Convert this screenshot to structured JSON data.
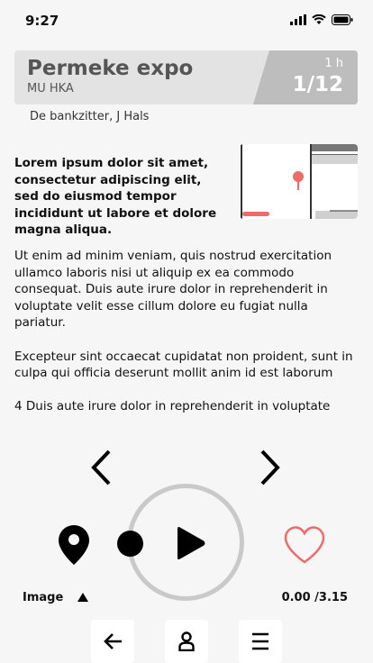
{
  "status": {
    "time": "9:27"
  },
  "header": {
    "title": "Permeke expo",
    "subtitle": "MU HKA",
    "duration": "1 h",
    "page": "1/12"
  },
  "artwork": "De bankzitter, J Hals",
  "lead_text": "Lorem ipsum dolor sit amet, consectetur adipiscing elit, sed do eiusmod tempor incididunt ut labore et dolore magna aliqua.",
  "paragraphs": [
    "Ut enim ad minim veniam,  quis nostrud exercitation ullamco laboris nisi ut aliquip ex ea commodo consequat. Duis aute irure dolor in reprehenderit in voluptate velit esse cillum dolore eu fugiat nulla pariatur.",
    "Excepteur sint occaecat cupidatat non proident, sunt in culpa qui officia deserunt mollit anim id est laborum",
    "4 Duis aute irure dolor in reprehenderit in voluptate"
  ],
  "player": {
    "media_label": "Image",
    "time": "0.00 /3.15"
  },
  "colors": {
    "accent": "#f06a6a",
    "header_badge": "#bdbdbd",
    "ring": "#c9c9c9"
  },
  "icons": [
    "signal-icon",
    "wifi-icon",
    "battery-icon",
    "map-pin-icon",
    "chevron-left-icon",
    "chevron-right-icon",
    "location-pin-icon",
    "play-icon",
    "heart-icon",
    "triangle-up-icon",
    "arrow-left-icon",
    "profile-icon",
    "menu-icon"
  ]
}
